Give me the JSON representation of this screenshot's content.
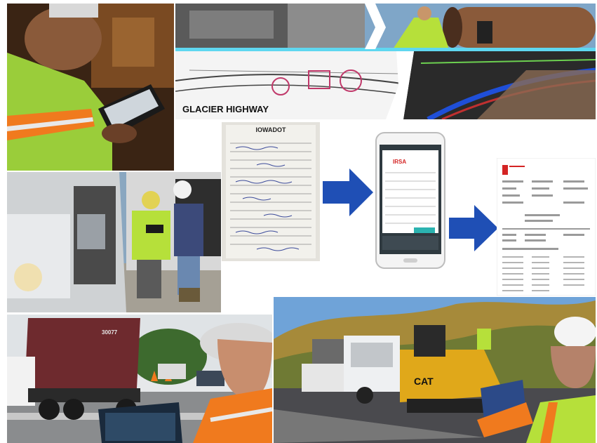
{
  "collage": {
    "plan_label": "GLACIER HIGHWAY",
    "slip_brand": "IOWADOT",
    "phone_brand": "IRSA",
    "truck_number": "30077",
    "paver_brand": "CAT",
    "colors": {
      "arrow_blue": "#1f4fb5",
      "safety_green": "#b6e03a",
      "safety_orange": "#f07a1e",
      "truck_maroon": "#6e2a2e",
      "paver_yellow": "#e0a81a",
      "sky_blue": "#6fa3d8"
    },
    "icons": [
      "right-arrow-icon",
      "right-arrow-icon"
    ]
  }
}
